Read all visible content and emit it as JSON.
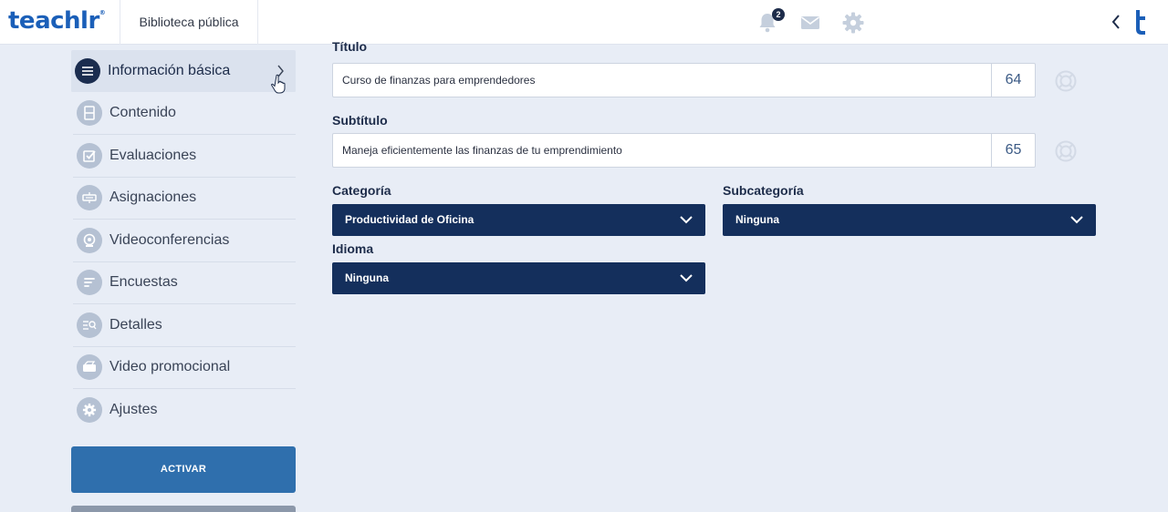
{
  "header": {
    "logo": "teachlr",
    "logo_mark": "®",
    "library": "Biblioteca pública",
    "notifications_count": "2",
    "icons": [
      "bell-icon",
      "mail-icon",
      "gear-icon",
      "chevron-left-icon",
      "teachlr-t-icon"
    ]
  },
  "sidebar": {
    "items": [
      {
        "label": "Información básica",
        "icon": "lines-icon",
        "active": true
      },
      {
        "label": "Contenido",
        "icon": "film-icon"
      },
      {
        "label": "Evaluaciones",
        "icon": "checkbox-icon"
      },
      {
        "label": "Asignaciones",
        "icon": "assignment-icon"
      },
      {
        "label": "Videoconferencias",
        "icon": "webcam-icon"
      },
      {
        "label": "Encuestas",
        "icon": "survey-icon"
      },
      {
        "label": "Detalles",
        "icon": "details-icon"
      },
      {
        "label": "Video promocional",
        "icon": "video-card-icon"
      },
      {
        "label": "Ajustes",
        "icon": "gear-icon"
      }
    ],
    "activate_label": "ACTIVAR"
  },
  "form": {
    "title_label": "Título",
    "title_value": "Curso de finanzas para emprendedores",
    "title_count": "64",
    "subtitle_label": "Subtítulo",
    "subtitle_value": "Maneja eficientemente las finanzas de tu emprendimiento",
    "subtitle_count": "65",
    "category_label": "Categoría",
    "category_value": "Productividad de Oficina",
    "subcategory_label": "Subcategoría",
    "subcategory_value": "Ninguna",
    "language_label": "Idioma",
    "language_value": "Ninguna"
  },
  "colors": {
    "brand": "#1b5fb8",
    "navy": "#142f5c",
    "button": "#2f6fad",
    "background": "#e8edf6"
  }
}
